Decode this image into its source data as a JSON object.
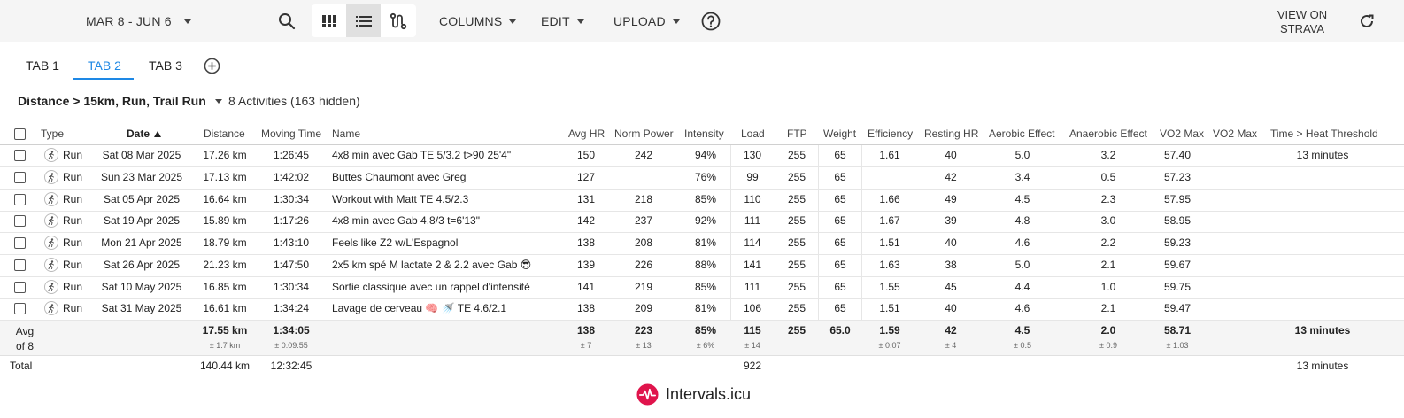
{
  "toolbar": {
    "date_range": "MAR 8 - JUN 6",
    "columns_label": "COLUMNS",
    "edit_label": "EDIT",
    "upload_label": "UPLOAD",
    "view_on_strava_line1": "VIEW ON",
    "view_on_strava_line2": "STRAVA"
  },
  "tabs": [
    {
      "label": "TAB 1",
      "active": false
    },
    {
      "label": "TAB 2",
      "active": true
    },
    {
      "label": "TAB 3",
      "active": false
    }
  ],
  "filter": {
    "label": "Distance > 15km, Run, Trail Run",
    "count": "8 Activities (163 hidden)"
  },
  "columns": {
    "type": "Type",
    "date": "Date",
    "distance": "Distance",
    "moving_time": "Moving Time",
    "name": "Name",
    "avg_hr": "Avg HR",
    "norm_power": "Norm Power",
    "intensity": "Intensity",
    "load": "Load",
    "ftp": "FTP",
    "weight": "Weight",
    "efficiency": "Efficiency",
    "resting_hr": "Resting HR",
    "aerobic_effect": "Aerobic Effect",
    "anaerobic_effect": "Anaerobic Effect",
    "vo2max_1": "VO2 Max",
    "vo2max_2": "VO2 Max",
    "heat": "Time > Heat Threshold"
  },
  "rows": [
    {
      "type": "Run",
      "date": "Sat 08 Mar 2025",
      "distance": "17.26 km",
      "moving_time": "1:26:45",
      "name": "4x8 min avec Gab TE 5/3.2 t>90 25'4\"",
      "avg_hr": "150",
      "norm_power": "242",
      "intensity": "94%",
      "load": "130",
      "ftp": "255",
      "weight": "65",
      "efficiency": "1.61",
      "resting_hr": "40",
      "aerobic": "5.0",
      "anaerobic": "3.2",
      "vo2max": "57.40",
      "heat": "13 minutes"
    },
    {
      "type": "Run",
      "date": "Sun 23 Mar 2025",
      "distance": "17.13 km",
      "moving_time": "1:42:02",
      "name": "Buttes Chaumont avec Greg",
      "avg_hr": "127",
      "norm_power": "",
      "intensity": "76%",
      "load": "99",
      "ftp": "255",
      "weight": "65",
      "efficiency": "",
      "resting_hr": "42",
      "aerobic": "3.4",
      "anaerobic": "0.5",
      "vo2max": "57.23",
      "heat": ""
    },
    {
      "type": "Run",
      "date": "Sat 05 Apr 2025",
      "distance": "16.64 km",
      "moving_time": "1:30:34",
      "name": "Workout with Matt TE 4.5/2.3",
      "avg_hr": "131",
      "norm_power": "218",
      "intensity": "85%",
      "load": "110",
      "ftp": "255",
      "weight": "65",
      "efficiency": "1.66",
      "resting_hr": "49",
      "aerobic": "4.5",
      "anaerobic": "2.3",
      "vo2max": "57.95",
      "heat": ""
    },
    {
      "type": "Run",
      "date": "Sat 19 Apr 2025",
      "distance": "15.89 km",
      "moving_time": "1:17:26",
      "name": "4x8 min avec Gab 4.8/3 t=6'13\"",
      "avg_hr": "142",
      "norm_power": "237",
      "intensity": "92%",
      "load": "111",
      "ftp": "255",
      "weight": "65",
      "efficiency": "1.67",
      "resting_hr": "39",
      "aerobic": "4.8",
      "anaerobic": "3.0",
      "vo2max": "58.95",
      "heat": ""
    },
    {
      "type": "Run",
      "date": "Mon 21 Apr 2025",
      "distance": "18.79 km",
      "moving_time": "1:43:10",
      "name": "Feels like Z2 w/L'Espagnol",
      "avg_hr": "138",
      "norm_power": "208",
      "intensity": "81%",
      "load": "114",
      "ftp": "255",
      "weight": "65",
      "efficiency": "1.51",
      "resting_hr": "40",
      "aerobic": "4.6",
      "anaerobic": "2.2",
      "vo2max": "59.23",
      "heat": ""
    },
    {
      "type": "Run",
      "date": "Sat 26 Apr 2025",
      "distance": "21.23 km",
      "moving_time": "1:47:50",
      "name": "2x5 km spé M lactate 2 & 2.2 avec Gab 😎",
      "avg_hr": "139",
      "norm_power": "226",
      "intensity": "88%",
      "load": "141",
      "ftp": "255",
      "weight": "65",
      "efficiency": "1.63",
      "resting_hr": "38",
      "aerobic": "5.0",
      "anaerobic": "2.1",
      "vo2max": "59.67",
      "heat": ""
    },
    {
      "type": "Run",
      "date": "Sat 10 May 2025",
      "distance": "16.85 km",
      "moving_time": "1:30:34",
      "name": "Sortie classique avec un rappel d'intensité",
      "avg_hr": "141",
      "norm_power": "219",
      "intensity": "85%",
      "load": "111",
      "ftp": "255",
      "weight": "65",
      "efficiency": "1.55",
      "resting_hr": "45",
      "aerobic": "4.4",
      "anaerobic": "1.0",
      "vo2max": "59.75",
      "heat": ""
    },
    {
      "type": "Run",
      "date": "Sat 31 May 2025",
      "distance": "16.61 km",
      "moving_time": "1:34:24",
      "name": "Lavage de cerveau 🧠 🚿 TE 4.6/2.1",
      "avg_hr": "138",
      "norm_power": "209",
      "intensity": "81%",
      "load": "106",
      "ftp": "255",
      "weight": "65",
      "efficiency": "1.51",
      "resting_hr": "40",
      "aerobic": "4.6",
      "anaerobic": "2.1",
      "vo2max": "59.47",
      "heat": ""
    }
  ],
  "average": {
    "label_line1": "Avg",
    "label_line2": "of 8",
    "distance": "17.55 km",
    "distance_sd": "± 1.7 km",
    "moving_time": "1:34:05",
    "moving_time_sd": "± 0:09:55",
    "avg_hr": "138",
    "avg_hr_sd": "± 7",
    "norm_power": "223",
    "norm_power_sd": "± 13",
    "intensity": "85%",
    "intensity_sd": "± 6%",
    "load": "115",
    "load_sd": "± 14",
    "ftp": "255",
    "weight": "65.0",
    "efficiency": "1.59",
    "efficiency_sd": "± 0.07",
    "resting_hr": "42",
    "resting_hr_sd": "± 4",
    "aerobic": "4.5",
    "aerobic_sd": "± 0.5",
    "anaerobic": "2.0",
    "anaerobic_sd": "± 0.9",
    "vo2max": "58.71",
    "vo2max_sd": "± 1.03",
    "heat": "13 minutes"
  },
  "total": {
    "label": "Total",
    "distance": "140.44 km",
    "moving_time": "12:32:45",
    "load": "922",
    "heat": "13 minutes"
  },
  "brand": {
    "name": "Intervals.icu",
    "color": "#e0144c"
  },
  "colors": {
    "accent": "#1e88e5"
  }
}
